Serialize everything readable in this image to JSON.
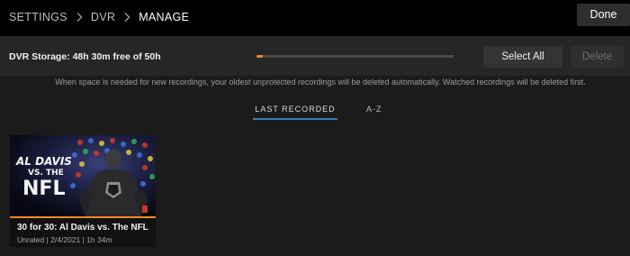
{
  "breadcrumb": {
    "items": [
      "SETTINGS",
      "DVR",
      "MANAGE"
    ]
  },
  "header": {
    "done_label": "Done"
  },
  "storage": {
    "label": "DVR Storage: 48h 30m free of 50h",
    "used_fraction": 0.03,
    "select_all_label": "Select All",
    "delete_label": "Delete"
  },
  "info_text": "When space is needed for new recordings, your oldest unprotected recordings will be deleted automatically. Watched recordings will be deleted first.",
  "tabs": [
    {
      "label": "LAST RECORDED",
      "active": true
    },
    {
      "label": "A-Z",
      "active": false
    }
  ],
  "recordings": [
    {
      "title": "30 for 30: Al Davis vs. The NFL",
      "meta": "Unrated | 2/4/2021 | 1h 34m",
      "thumb_text": [
        "AL DAVIS",
        "VS. THE",
        "NFL"
      ],
      "watched_fraction": 1.0
    }
  ],
  "colors": {
    "accent_orange": "#f08a24",
    "tab_underline": "#3a7bb4",
    "background": "#1b1b1b",
    "topbar": "#000000"
  }
}
